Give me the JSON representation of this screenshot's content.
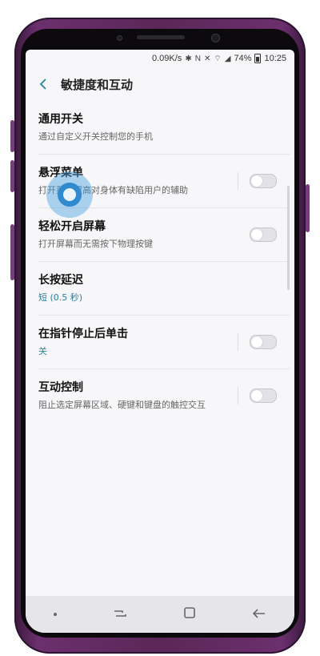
{
  "status": {
    "speed": "0.09K/s",
    "battery_percent": "74%",
    "time": "10:25"
  },
  "header": {
    "title": "敏捷度和互动"
  },
  "items": [
    {
      "title": "通用开关",
      "subtitle": "通过自定义开关控制您的手机",
      "has_switch": false
    },
    {
      "title": "悬浮菜单",
      "subtitle": "打开菜单提高对身体有缺陷用户的辅助",
      "has_switch": true,
      "switch_on": false
    },
    {
      "title": "轻松开启屏幕",
      "subtitle": "打开屏幕而无需按下物理按键",
      "has_switch": true,
      "switch_on": false
    },
    {
      "title": "长按延迟",
      "subtitle": "短 (0.5 秒)",
      "has_switch": false
    },
    {
      "title": "在指针停止后单击",
      "subtitle": "关",
      "has_switch": true,
      "switch_on": false
    },
    {
      "title": "互动控制",
      "subtitle": "阻止选定屏幕区域、硬键和键盘的触控交互",
      "has_switch": true,
      "switch_on": false
    }
  ],
  "icons": {
    "back": "chevron-left-icon",
    "nav_recent": "recent-apps-icon",
    "nav_home": "home-icon",
    "nav_back": "back-arrow-icon"
  },
  "colors": {
    "accent": "#2d7ea0",
    "touch_indicator": "#2f8ad0",
    "phone_frame": "#5a2757"
  }
}
